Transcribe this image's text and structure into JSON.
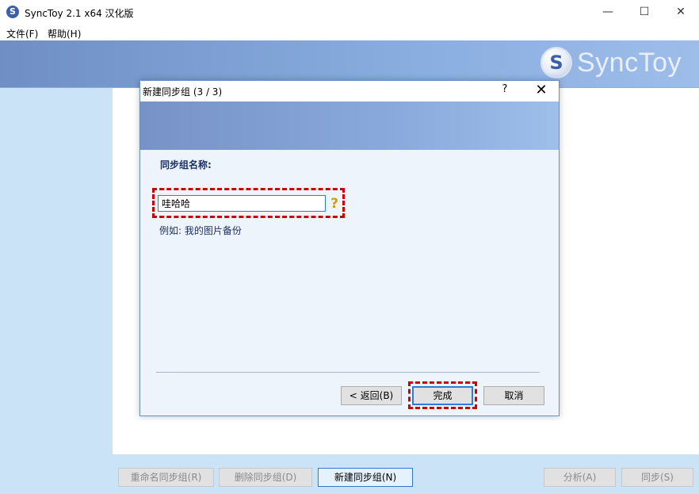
{
  "window": {
    "title": "SyncToy 2.1 x64 汉化版",
    "app_icon": "sync-icon",
    "minimize": "—",
    "maximize": "☐",
    "close": "✕"
  },
  "menu": {
    "file": "文件(F)",
    "help": "帮助(H)"
  },
  "logo": {
    "mark": "S",
    "text": "SyncToy"
  },
  "dialog": {
    "title": "新建同步组 (3 / 3)",
    "help_btn": "?",
    "close_btn": "✕",
    "label": "同步组名称:",
    "input_value": "哇哈哈",
    "help_icon": "?",
    "example": "例如: 我的图片备份",
    "back_btn": "< 返回(B)",
    "finish_btn": "完成",
    "cancel_btn": "取消"
  },
  "bottom": {
    "rename": "重命名同步组(R)",
    "delete": "删除同步组(D)",
    "new": "新建同步组(N)",
    "analyze": "分析(A)",
    "sync": "同步(S)"
  },
  "colors": {
    "accent": "#2f7ad6",
    "highlight": "#d10000",
    "sidebar": "#cbe3f7"
  }
}
